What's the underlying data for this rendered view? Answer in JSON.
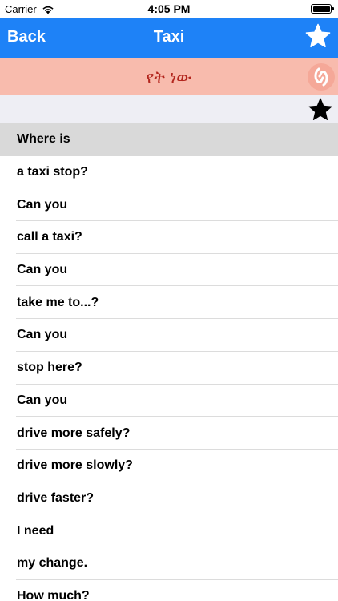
{
  "status_bar": {
    "carrier": "Carrier",
    "time": "4:05 PM",
    "icons": [
      "wifi-icon",
      "battery-icon"
    ]
  },
  "nav": {
    "back_label": "Back",
    "title": "Taxi",
    "star_icon": "star-outline-icon",
    "color": "#1e82f7"
  },
  "translation": {
    "text": "የት ነው",
    "speak_icon": "speaker-icon",
    "background": "#f8bbad",
    "text_color": "#b3261e"
  },
  "favorites_bar": {
    "star_icon": "star-filled-icon"
  },
  "phrases": [
    {
      "label": "Where is",
      "selected": true
    },
    {
      "label": "a taxi stop?"
    },
    {
      "label": "Can you"
    },
    {
      "label": "call a taxi?"
    },
    {
      "label": "Can you"
    },
    {
      "label": "take me to...?"
    },
    {
      "label": "Can you"
    },
    {
      "label": "stop here?"
    },
    {
      "label": "Can you"
    },
    {
      "label": "drive more safely?"
    },
    {
      "label": "drive more slowly?"
    },
    {
      "label": "drive faster?"
    },
    {
      "label": "I need"
    },
    {
      "label": "my change."
    },
    {
      "label": "How much?"
    }
  ]
}
